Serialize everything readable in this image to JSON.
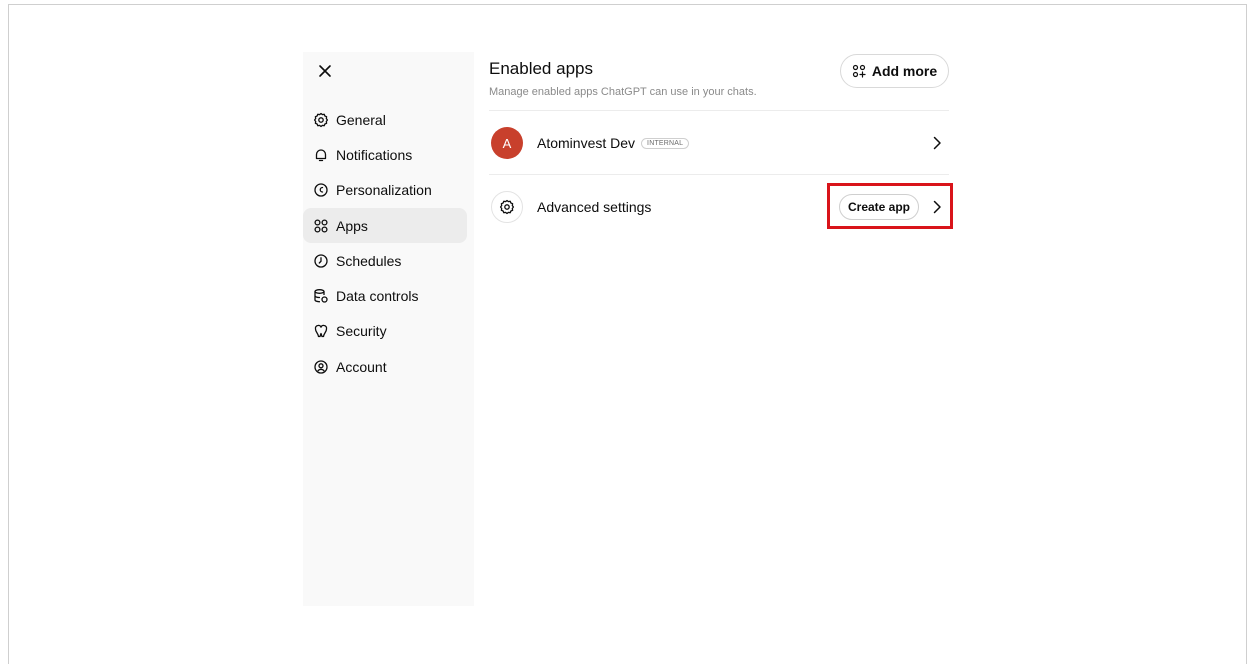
{
  "sidebar": {
    "close_icon": "close-icon",
    "items": [
      {
        "label": "General",
        "icon": "gear-icon"
      },
      {
        "label": "Notifications",
        "icon": "bell-icon"
      },
      {
        "label": "Personalization",
        "icon": "personalization-icon"
      },
      {
        "label": "Apps",
        "icon": "apps-grid-icon",
        "active": true
      },
      {
        "label": "Schedules",
        "icon": "clock-icon"
      },
      {
        "label": "Data controls",
        "icon": "database-icon"
      },
      {
        "label": "Security",
        "icon": "shield-icon"
      },
      {
        "label": "Account",
        "icon": "account-icon"
      }
    ]
  },
  "main": {
    "title": "Enabled apps",
    "subtitle": "Manage enabled apps ChatGPT can use in your chats.",
    "add_more_label": "Add more",
    "apps": [
      {
        "avatar_letter": "A",
        "name": "Atominvest Dev",
        "badge": "INTERNAL"
      }
    ],
    "advanced": {
      "label": "Advanced settings",
      "create_app_label": "Create app"
    }
  },
  "colors": {
    "sidebar_bg": "#f9f9f9",
    "active_item_bg": "#ececec",
    "avatar_bg": "#c8402c",
    "highlight": "#d9141a"
  }
}
